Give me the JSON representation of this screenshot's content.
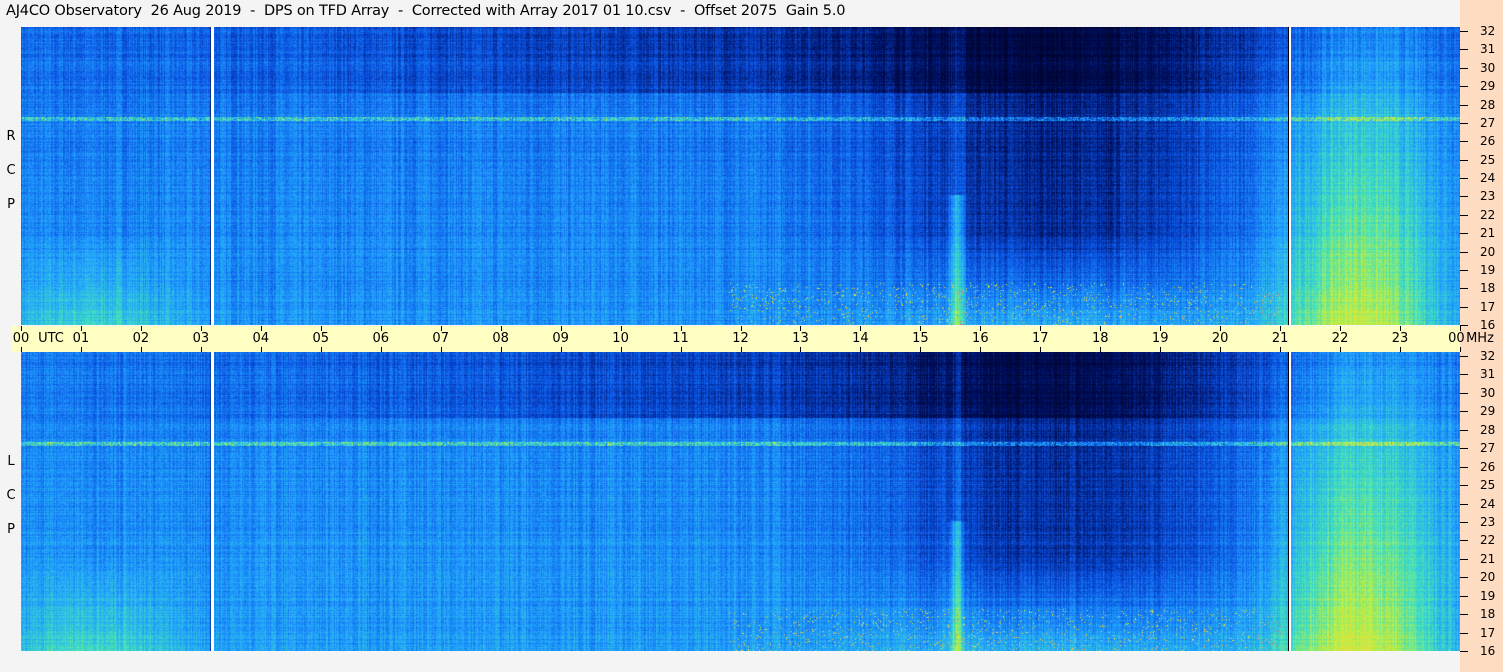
{
  "title": "AJ4CO Observatory  26 Aug 2019  -  DPS on TFD Array  -  Corrected with Array 2017 01 10.csv  -  Offset 2075  Gain 5.0",
  "chart_data": {
    "type": "heatmap",
    "title": "AJ4CO Observatory  26 Aug 2019  -  DPS on TFD Array  -  Corrected with Array 2017 01 10.csv  -  Offset 2075  Gain 5.0",
    "xlabel": "UTC",
    "ylabel": "MHz",
    "xlim": [
      0,
      24
    ],
    "ylim": [
      16,
      32
    ],
    "x_ticks": [
      "00",
      "01",
      "02",
      "03",
      "04",
      "05",
      "06",
      "07",
      "08",
      "09",
      "10",
      "11",
      "12",
      "13",
      "14",
      "15",
      "16",
      "17",
      "18",
      "19",
      "20",
      "21",
      "22",
      "23",
      "00"
    ],
    "y_ticks": [
      "16",
      "17",
      "18",
      "19",
      "20",
      "21",
      "22",
      "23",
      "24",
      "25",
      "26",
      "27",
      "28",
      "29",
      "30",
      "31",
      "32"
    ],
    "panels": [
      {
        "label": [
          "R",
          "C",
          "P"
        ]
      },
      {
        "label": [
          "L",
          "C",
          "P"
        ]
      }
    ],
    "markers_utc": [
      3.18,
      21.15
    ],
    "colormap": [
      "#000020",
      "#001060",
      "#0a50e0",
      "#20a0ff",
      "#40e0c0",
      "#c0f040",
      "#ffd040",
      "#ff4080",
      "#ff40ff"
    ]
  }
}
